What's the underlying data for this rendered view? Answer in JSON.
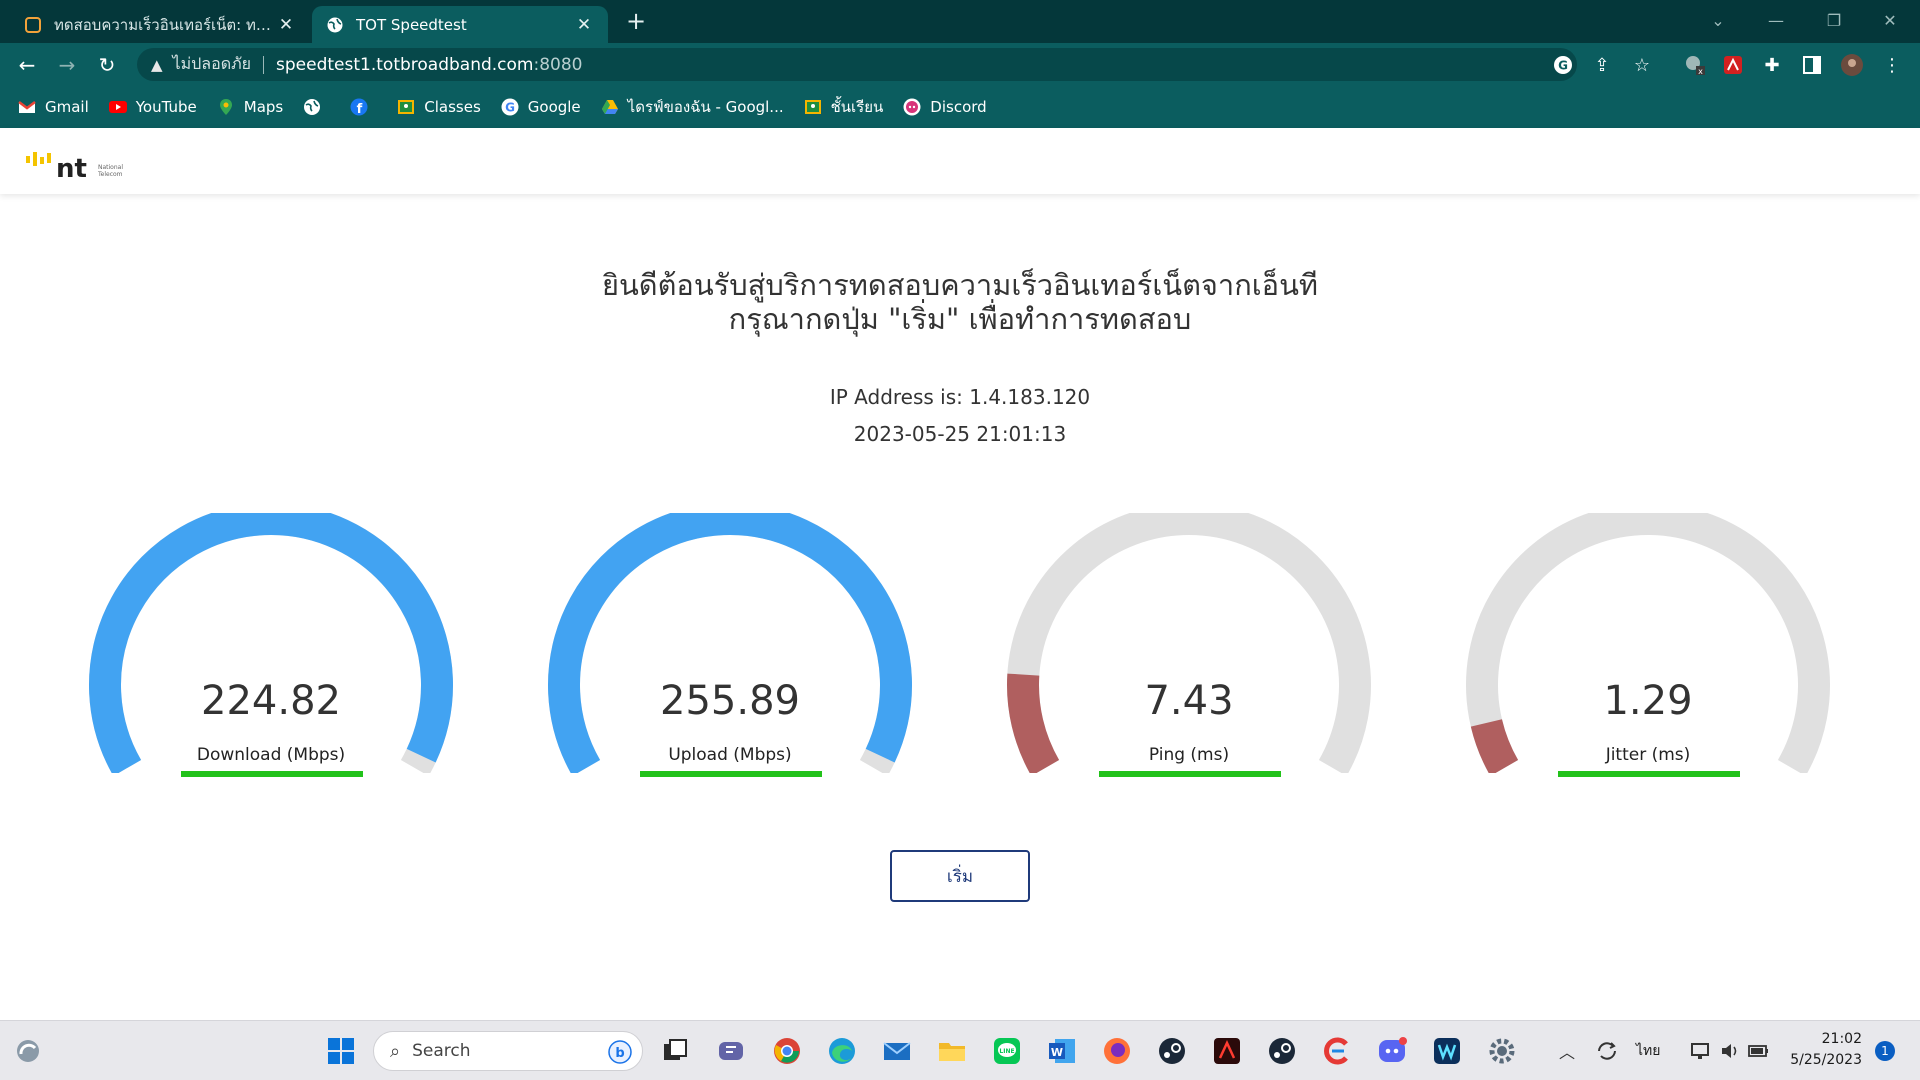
{
  "browser": {
    "tabs": [
      {
        "title": "ทดสอบความเร็วอินเทอร์เน็ต: ทดสอบความเร็วอินเทอร์เน็ต",
        "active": false
      },
      {
        "title": "TOT Speedtest",
        "active": true
      }
    ],
    "new_tab_label": "+",
    "address": {
      "security_label": "ไม่ปลอดภัย",
      "host": "speedtest1.totbroadband.com",
      "port": ":8080"
    },
    "bookmarks": [
      {
        "label": "Gmail",
        "icon": "gmail-icon"
      },
      {
        "label": "YouTube",
        "icon": "youtube-icon"
      },
      {
        "label": "Maps",
        "icon": "maps-icon"
      },
      {
        "label": "",
        "icon": "globe-icon"
      },
      {
        "label": "",
        "icon": "facebook-icon"
      },
      {
        "label": "Classes",
        "icon": "classroom-icon"
      },
      {
        "label": "Google",
        "icon": "google-icon"
      },
      {
        "label": "ไดรฟ์ของฉัน - Googl...",
        "icon": "drive-icon"
      },
      {
        "label": "ชั้นเรียน",
        "icon": "classroom-icon"
      },
      {
        "label": "Discord",
        "icon": "discord-icon"
      }
    ]
  },
  "page": {
    "welcome_line1": "ยินดีต้อนรับสู่บริการทดสอบความเร็วอินเทอร์เน็ตจากเอ็นที",
    "welcome_line2": "กรุณากดปุ่ม \"เริ่ม\" เพื่อทำการทดสอบ",
    "ip_text": "IP Address is: 1.4.183.120",
    "datetime": "2023-05-25 21:01:13",
    "start_label": "เริ่ม",
    "gauges": [
      {
        "value": "224.82",
        "label": "Download (Mbps)",
        "fill": 0.98,
        "color": "#42a3f2"
      },
      {
        "value": "255.89",
        "label": "Upload (Mbps)",
        "fill": 0.98,
        "color": "#42a3f2"
      },
      {
        "value": "7.43",
        "label": "Ping (ms)",
        "fill": 0.14,
        "color": "#b05f5f"
      },
      {
        "value": "1.29",
        "label": "Jitter (ms)",
        "fill": 0.07,
        "color": "#b05f5f"
      }
    ],
    "colors": {
      "track": "#e0e0e0",
      "progress_bar": "#22c21a",
      "button_border": "#1f3a7a"
    }
  },
  "taskbar": {
    "search_placeholder": "Search",
    "tray": {
      "language": "ไทย",
      "time": "21:02",
      "date": "5/25/2023",
      "notifications": "1"
    }
  }
}
